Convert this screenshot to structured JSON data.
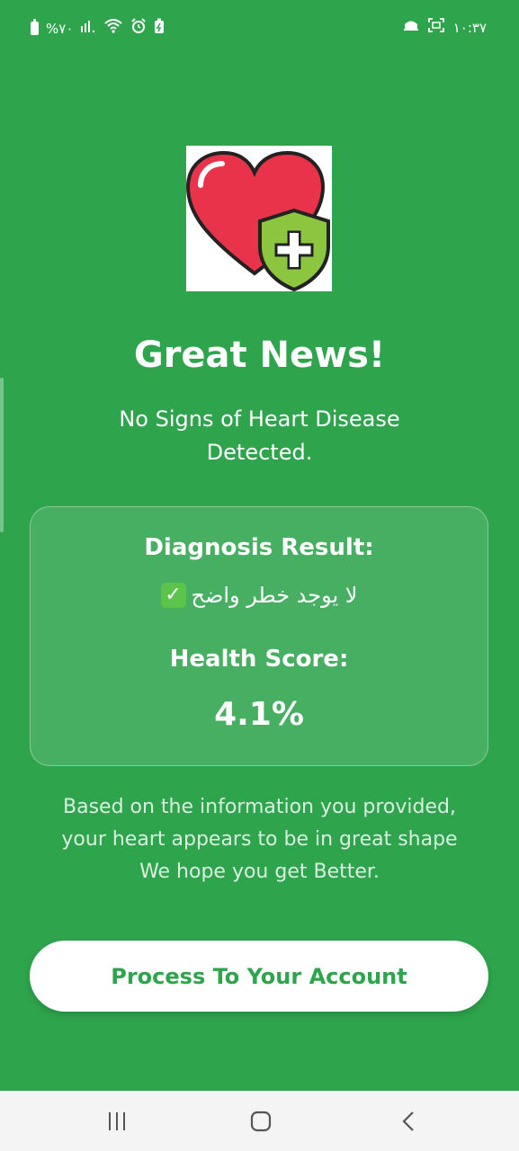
{
  "status_bar": {
    "battery_text": "%٧٠",
    "time": "١٠:٣٧",
    "left_icons": [
      "battery-icon",
      "signal-icon",
      "wifi-icon",
      "alarm-icon",
      "battery-saver-icon"
    ],
    "right_icons": [
      "notification-icon",
      "screenshot-icon"
    ]
  },
  "hero": {
    "logo_icon": "heart-shield-icon",
    "title": "Great News!",
    "subtitle": "No Signs of Heart Disease Detected."
  },
  "result_card": {
    "diagnosis_label": "Diagnosis Result:",
    "diagnosis_value": "لا يوجد خطر واضح",
    "diagnosis_icon": "check-mark-icon",
    "health_score_label": "Health Score:",
    "health_score_value": "4.1%"
  },
  "info": {
    "line1": "Based on the information you provided,",
    "line2": "your heart appears to be in great shape",
    "line3": "We hope you get Better."
  },
  "actions": {
    "proceed_label": "Process To Your Account"
  },
  "colors": {
    "background": "#2ea44d",
    "button_text": "#2ea44d",
    "heart": "#e8334a",
    "shield": "#8cc63f"
  },
  "nav_bar": {
    "icons": [
      "recent-apps-icon",
      "home-icon",
      "back-icon"
    ]
  }
}
